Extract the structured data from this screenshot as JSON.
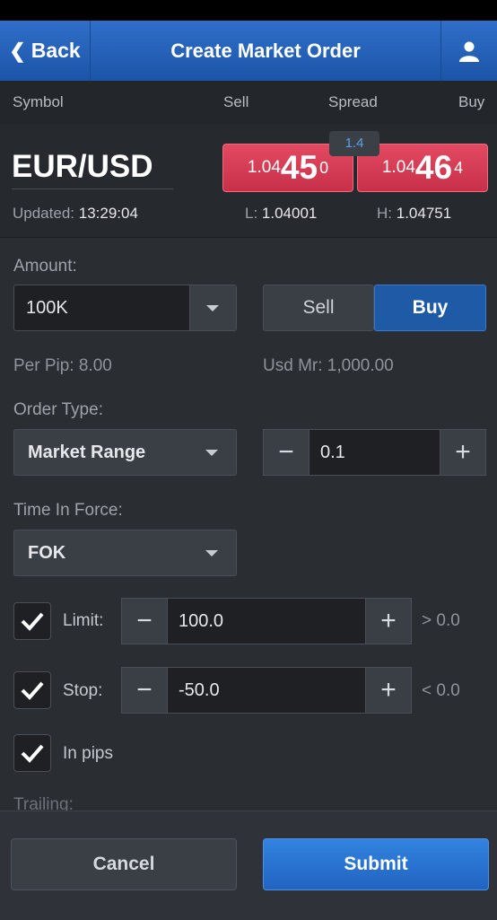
{
  "nav": {
    "back_label": "Back",
    "title": "Create Market Order",
    "user_icon": "user-icon"
  },
  "columns": {
    "symbol": "Symbol",
    "sell": "Sell",
    "spread": "Spread",
    "buy": "Buy"
  },
  "quote": {
    "symbol": "EUR/USD",
    "spread": "1.4",
    "sell": {
      "prefix": "1.04",
      "big": "45",
      "frac": "0"
    },
    "buy": {
      "prefix": "1.04",
      "big": "46",
      "frac": "4"
    },
    "updated_label": "Updated:",
    "updated_value": "13:29:04",
    "low_label": "L:",
    "low_value": "1.04001",
    "high_label": "H:",
    "high_value": "1.04751"
  },
  "amount": {
    "label": "Amount:",
    "value": "100K",
    "sell_label": "Sell",
    "buy_label": "Buy",
    "selected": "Buy"
  },
  "info": {
    "per_pip": "Per Pip: 8.00",
    "margin": "Usd Mr: 1,000.00"
  },
  "order_type": {
    "label": "Order Type:",
    "value": "Market Range",
    "range_value": "0.1"
  },
  "time_in_force": {
    "label": "Time In Force:",
    "value": "FOK"
  },
  "limit": {
    "checked": true,
    "label": "Limit:",
    "value": "100.0",
    "compare": "> 0.0"
  },
  "stop": {
    "checked": true,
    "label": "Stop:",
    "value": "-50.0",
    "compare": "< 0.0"
  },
  "in_pips": {
    "checked": true,
    "label": "In pips"
  },
  "trailing": {
    "label": "Trailing:"
  },
  "footer": {
    "cancel_label": "Cancel",
    "submit_label": "Submit"
  },
  "colors": {
    "nav": "#2368c4",
    "sell_price": "#d93a52",
    "buy_selected": "#1f5aa6",
    "submit": "#2b74d6",
    "spread_text": "#5aa2e6"
  }
}
